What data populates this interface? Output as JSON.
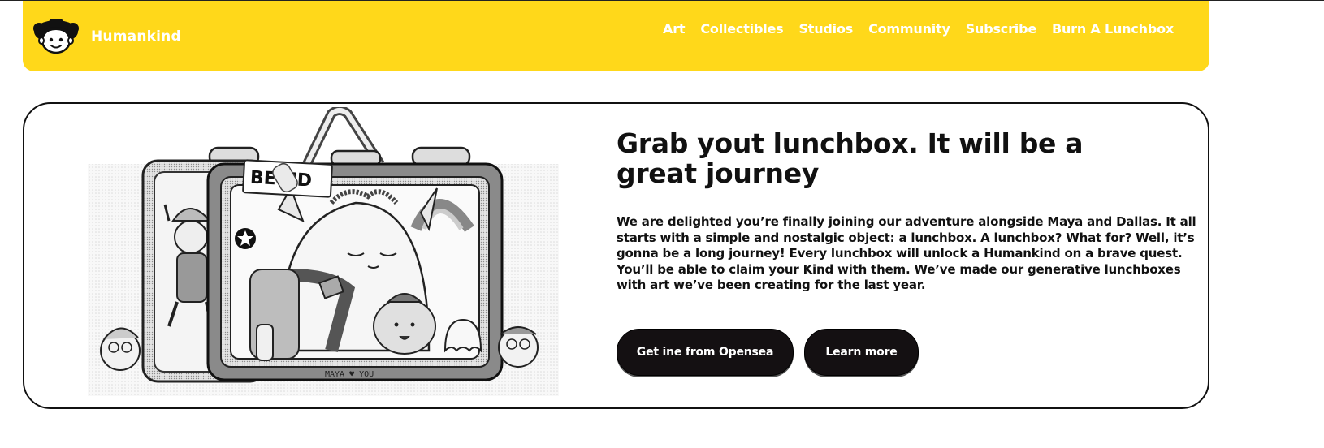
{
  "header": {
    "brand_name": "Humankind",
    "logo_icon": "smiling-face-logo",
    "accent_color": "#FFD81A",
    "nav": [
      {
        "label": "Art"
      },
      {
        "label": "Collectibles"
      },
      {
        "label": "Studios"
      },
      {
        "label": "Community"
      },
      {
        "label": "Subscribe"
      },
      {
        "label": "Burn A Lunchbox"
      }
    ]
  },
  "hero": {
    "title": "Grab yout lunchbox. It will be a great journey",
    "body": "We are delighted you’re finally joining our adventure alongside Maya and Dallas. It all starts with a simple and nostalgic object: a lunchbox. A lunchbox? What for? Well, it’s gonna be a long journey! Every lunchbox will unlock a Humankind on a brave quest. You’ll be able to claim your Kind with them. We’ve made our generative lunchboxes with art we’ve been creating for the last year.",
    "illustration": {
      "sticker_text": "BE  ND",
      "footer_text": "MAYA ♥ YOU"
    },
    "buttons": {
      "primary_label": "Get ine from Opensea",
      "secondary_label": "Learn more"
    }
  }
}
